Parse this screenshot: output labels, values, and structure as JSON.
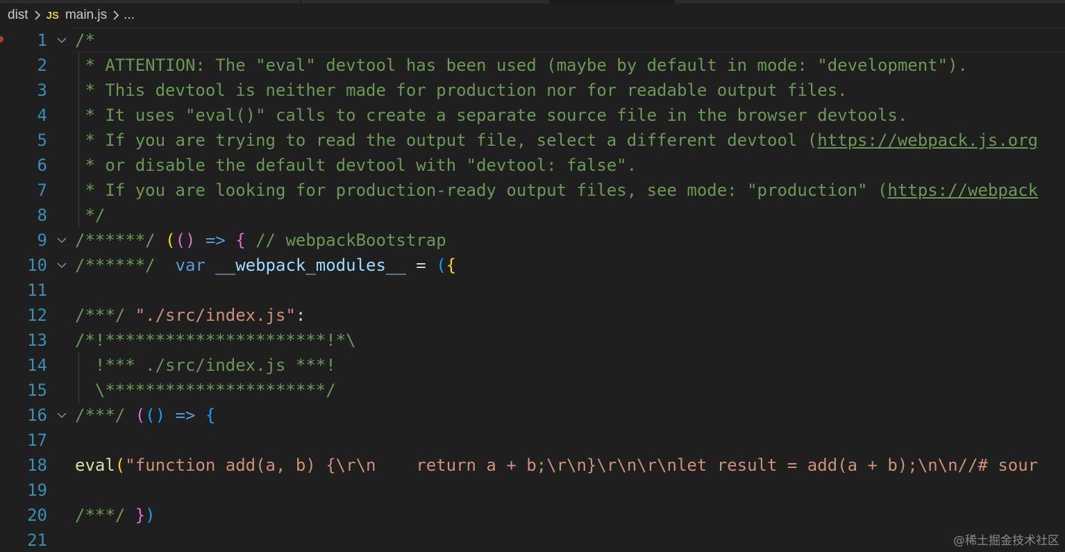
{
  "breadcrumb": {
    "items": [
      "dist",
      "main.js",
      "..."
    ],
    "file_type_icon": "JS"
  },
  "editor": {
    "lines": [
      {
        "n": "1",
        "fold": true,
        "tokens": [
          {
            "t": "/*",
            "c": "com"
          }
        ]
      },
      {
        "n": "2",
        "tokens": [
          {
            "t": " * ATTENTION: The \"eval\" devtool has been used (maybe by default in mode: \"development\").",
            "c": "com"
          }
        ]
      },
      {
        "n": "3",
        "tokens": [
          {
            "t": " * This devtool is neither made for production nor for readable output files.",
            "c": "com"
          }
        ]
      },
      {
        "n": "4",
        "tokens": [
          {
            "t": " * It uses \"eval()\" calls to create a separate source file in the browser devtools.",
            "c": "com"
          }
        ]
      },
      {
        "n": "5",
        "tokens": [
          {
            "t": " * If you are trying to read the output file, select a different devtool (",
            "c": "com"
          },
          {
            "t": "https://webpack.js.org",
            "c": "com link"
          }
        ]
      },
      {
        "n": "6",
        "tokens": [
          {
            "t": " * or disable the default devtool with \"devtool: false\".",
            "c": "com"
          }
        ]
      },
      {
        "n": "7",
        "tokens": [
          {
            "t": " * If you are looking for production-ready output files, see mode: \"production\" (",
            "c": "com"
          },
          {
            "t": "https://webpack",
            "c": "com link"
          }
        ]
      },
      {
        "n": "8",
        "tokens": [
          {
            "t": " */",
            "c": "com"
          }
        ]
      },
      {
        "n": "9",
        "fold": true,
        "tokens": [
          {
            "t": "/******/ ",
            "c": "com"
          },
          {
            "t": "(",
            "c": "b1"
          },
          {
            "t": "()",
            "c": "b2"
          },
          {
            "t": " => ",
            "c": "kw"
          },
          {
            "t": "{",
            "c": "b2"
          },
          {
            "t": " // webpackBootstrap",
            "c": "com"
          }
        ]
      },
      {
        "n": "10",
        "fold": true,
        "tokens": [
          {
            "t": "/******/ ",
            "c": "com"
          },
          {
            "t": " var",
            "c": "kw"
          },
          {
            "t": " __webpack_modules__",
            "c": "var"
          },
          {
            "t": " = ",
            "c": "txt"
          },
          {
            "t": "(",
            "c": "b3"
          },
          {
            "t": "{",
            "c": "b1"
          }
        ]
      },
      {
        "n": "11",
        "tokens": []
      },
      {
        "n": "12",
        "tokens": [
          {
            "t": "/***/ ",
            "c": "com"
          },
          {
            "t": "\"./src/index.js\"",
            "c": "str"
          },
          {
            "t": ":",
            "c": "txt"
          }
        ]
      },
      {
        "n": "13",
        "tokens": [
          {
            "t": "/*!**********************!*\\",
            "c": "com"
          }
        ]
      },
      {
        "n": "14",
        "tokens": [
          {
            "t": "  !*** ./src/index.js ***!",
            "c": "com"
          }
        ]
      },
      {
        "n": "15",
        "tokens": [
          {
            "t": "  \\**********************/",
            "c": "com"
          }
        ]
      },
      {
        "n": "16",
        "fold": true,
        "tokens": [
          {
            "t": "/***/ ",
            "c": "com"
          },
          {
            "t": "(",
            "c": "b2"
          },
          {
            "t": "()",
            "c": "b3"
          },
          {
            "t": " => ",
            "c": "kw"
          },
          {
            "t": "{",
            "c": "b3"
          }
        ]
      },
      {
        "n": "17",
        "tokens": []
      },
      {
        "n": "18",
        "tokens": [
          {
            "t": "eval",
            "c": "fn"
          },
          {
            "t": "(",
            "c": "b1"
          },
          {
            "t": "\"function add(a, b) {\\r\\n    return a + b;\\r\\n}\\r\\n\\r\\nlet result = add(a + b);\\n\\n//# sour",
            "c": "str"
          }
        ]
      },
      {
        "n": "19",
        "tokens": []
      },
      {
        "n": "20",
        "tokens": [
          {
            "t": "/***/ ",
            "c": "com"
          },
          {
            "t": "}",
            "c": "b2"
          },
          {
            "t": ")",
            "c": "b3"
          }
        ]
      },
      {
        "n": "21",
        "tokens": []
      }
    ]
  },
  "watermark": "@稀土掘金技术社区",
  "colors": {
    "background": "#1f1f1f",
    "line_number": "#3a8fb7",
    "comment": "#6a9955",
    "string": "#ce9178",
    "keyword": "#569cd6",
    "variable": "#9cdcfe",
    "function": "#dcdcaa",
    "breakpoint": "#b73a34"
  },
  "icons": {
    "breadcrumb_separator": "chevron-right-icon",
    "fold": "chevron-down-icon",
    "gutter_marker": "breakpoint-icon"
  }
}
